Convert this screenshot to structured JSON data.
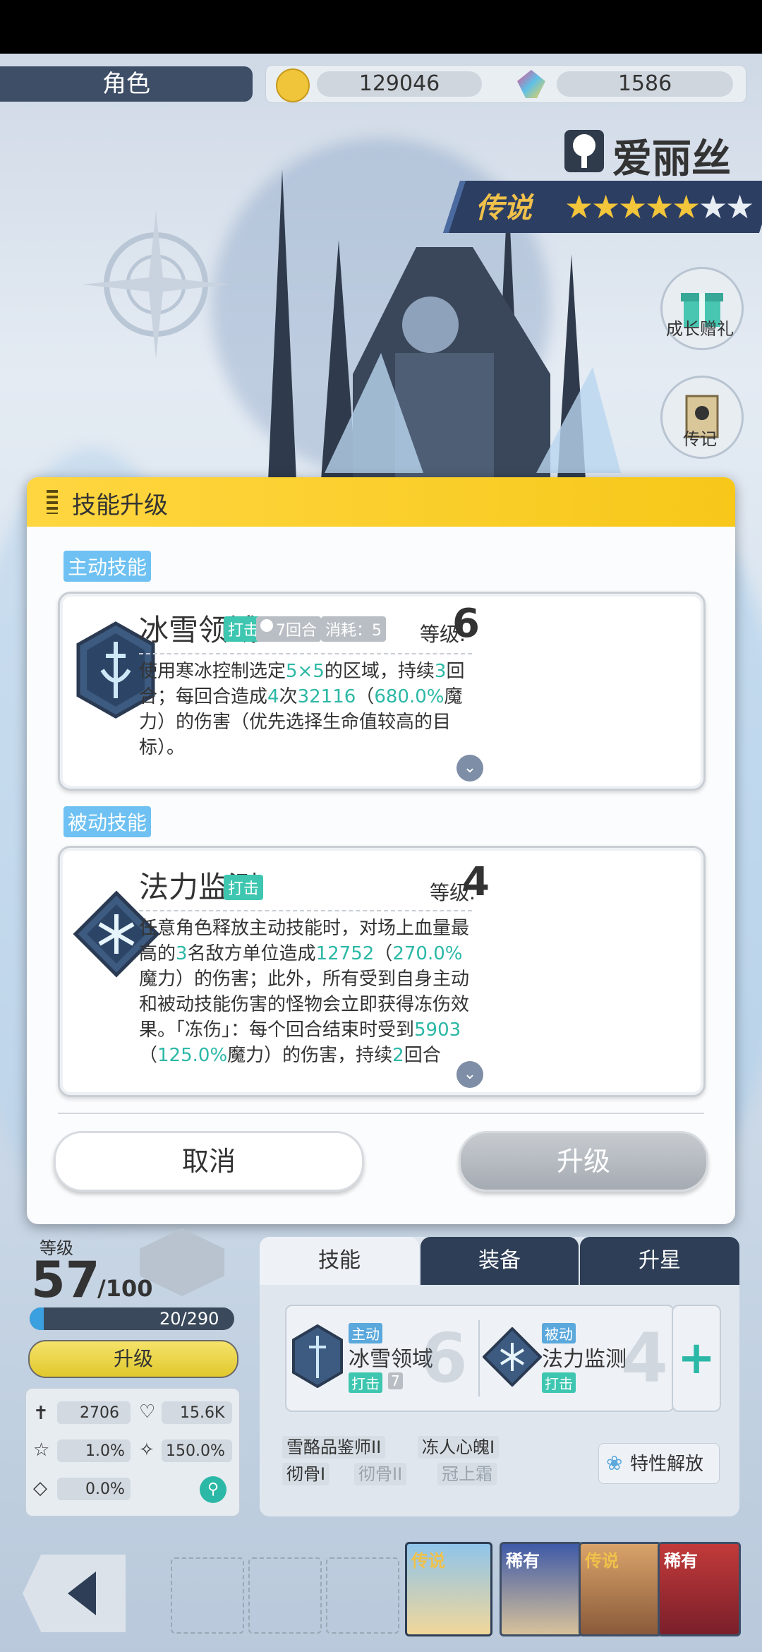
{
  "top": {
    "screen_title": "角色",
    "gold": "129046",
    "crystals": "1586"
  },
  "character": {
    "name": "爱丽丝",
    "rarity": "传说",
    "stars_filled": 5,
    "stars_total": 7,
    "side_buttons": [
      "成长赠礼",
      "传记"
    ]
  },
  "modal": {
    "title": "技能升级",
    "active_section": "主动技能",
    "passive_section": "被动技能",
    "active_skill": {
      "name": "冰雪领域",
      "type": "打击",
      "cooldown": "7回合",
      "cost": "消耗：5",
      "level_label": "等级.",
      "level": "6",
      "desc": {
        "p1": "使用寒冰控制选定",
        "h1": "5×5",
        "p2": "的区域，持续",
        "h2": "3",
        "p3": "回合；每回合造成",
        "h3": "4",
        "p4": "次",
        "h4": "32116",
        "p5": "（",
        "h5": "680.0%",
        "p6": "魔力）的伤害（优先选择生命值较高的目标）。"
      }
    },
    "passive_skill": {
      "name": "法力监测",
      "type": "打击",
      "level_label": "等级.",
      "level": "4",
      "desc": {
        "p1": "任意角色释放主动技能时，对场上血量最高的",
        "h1": "3",
        "p2": "名敌方单位造成",
        "h2": "12752",
        "p3": "（",
        "h3": "270.0%",
        "p4": "魔力）的伤害；此外，所有受到自身主动和被动技能伤害的怪物会立即获得冻伤效果。「冻伤」：每个回合结束时受到",
        "h4": "5903",
        "p5": "（",
        "h5": "125.0%",
        "p6": "魔力）的伤害，持续",
        "h6": "2",
        "p7": "回合"
      }
    },
    "cancel_label": "取消",
    "upgrade_label": "升级"
  },
  "bottom": {
    "level_label": "等级",
    "level": "57",
    "level_max": "/100",
    "exp_text": "20/290",
    "exp_fraction": 0.069,
    "levelup_label": "升级",
    "stats": {
      "atk": "2706",
      "hp": "15.6K",
      "crit": "1.0%",
      "crit_dmg": "150.0%",
      "dodge": "0.0%"
    },
    "tabs": [
      "技能",
      "装备",
      "升星"
    ],
    "slot_active_tag": "主动",
    "slot_active_name": "冰雪领域",
    "slot_active_type": "打击",
    "slot_active_cd": "7",
    "slot_active_level": "6",
    "slot_passive_tag": "被动",
    "slot_passive_name": "法力监测",
    "slot_passive_type": "打击",
    "slot_passive_level": "4",
    "traits": [
      "雪酪品鉴师II",
      "冻人心魄I",
      "彻骨I",
      "彻骨II",
      "冠上霜"
    ],
    "trait_button": "特性解放",
    "roster_tags": [
      "传说",
      "稀有",
      "传说",
      "稀有"
    ]
  },
  "colors": {
    "accent_yellow": "#f7c81a",
    "highlight_teal": "#2cb8a6",
    "navy": "#3d4e66"
  }
}
